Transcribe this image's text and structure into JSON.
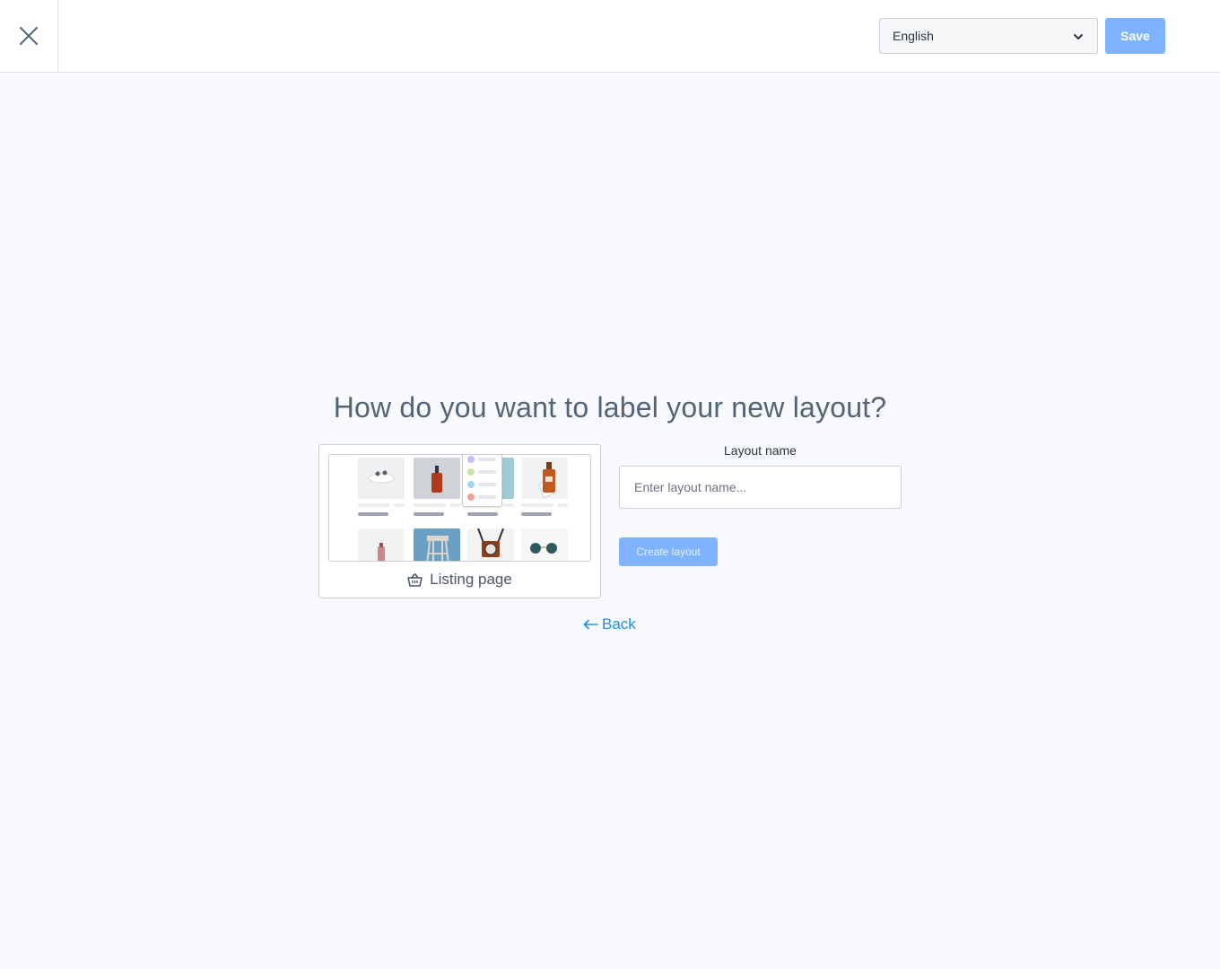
{
  "header": {
    "language": {
      "selected": "English"
    },
    "save_label": "Save"
  },
  "main": {
    "heading": "How do you want to label your new layout?",
    "card": {
      "label": "Listing page"
    },
    "form": {
      "label": "Layout name",
      "placeholder": "Enter layout name...",
      "value": "",
      "create_label": "Create layout"
    },
    "back_label": "Back"
  },
  "icons": [
    "close-icon",
    "chevron-down-icon",
    "basket-icon",
    "arrow-left-icon"
  ],
  "colors": {
    "accent": "#7fb2ff",
    "link": "#1f8fe0",
    "background": "#f8f9fc"
  }
}
